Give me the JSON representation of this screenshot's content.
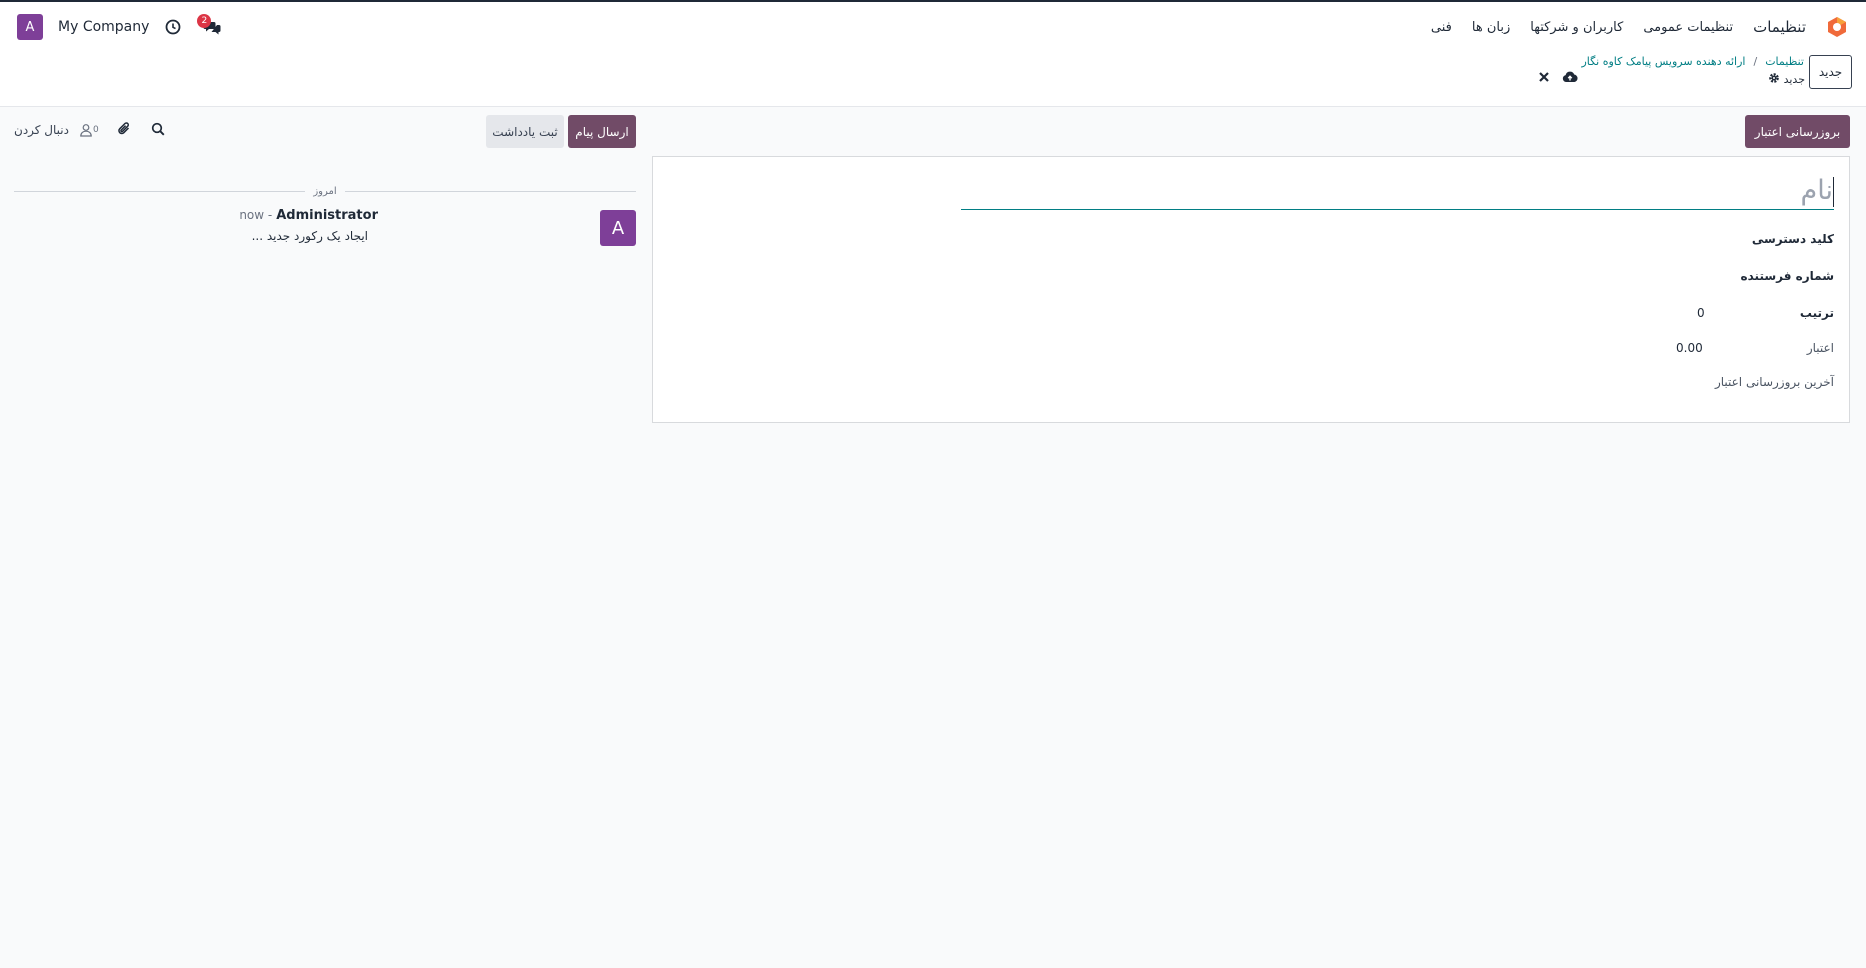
{
  "user": {
    "avatar_letter": "A",
    "company": "My Company"
  },
  "notifications": {
    "messages_count": "2"
  },
  "nav": {
    "app_name": "تنظیمات",
    "menu": [
      "تنظیمات عمومی",
      "کاربران و شرکتها",
      "زبان ها",
      "فنی"
    ]
  },
  "control": {
    "new_button": "جدید",
    "breadcrumb": [
      "تنظیمات",
      "ارائه دهنده سرویس پیامک کاوه نگار"
    ],
    "breadcrumb_sep": "/",
    "record_title": "جدید"
  },
  "chatter": {
    "follow_label": "دنبال کردن",
    "followers_count": "0",
    "send_message": "ارسال پیام",
    "log_note": "ثبت یادداشت",
    "today": "امروز",
    "message": {
      "avatar_letter": "A",
      "author": "Administrator",
      "time": "now - ",
      "body": "ایجاد یک رکورد جدید ..."
    }
  },
  "form": {
    "update_credit_button": "بروزرسانی اعتبار",
    "name_placeholder": "نام",
    "fields": {
      "access_key": "کلید دسترسی",
      "sender_number": "شماره فرستنده",
      "sequence": "ترتیب",
      "sequence_value": "0",
      "credit": "اعتبار",
      "credit_value": "0.00",
      "last_credit_update": "آخرین بروزرسانی اعتبار"
    }
  },
  "colors": {
    "primary": "#714b67",
    "accent": "#017e84",
    "avatar": "#7e3f98",
    "badge": "#dc3545"
  }
}
